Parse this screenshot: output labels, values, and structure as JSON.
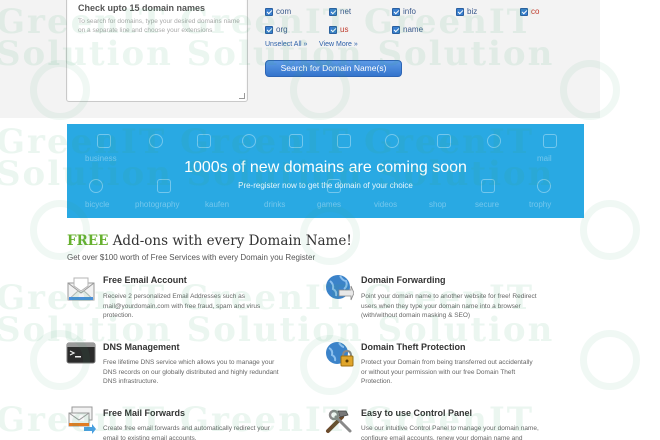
{
  "search": {
    "textarea_title": "Check upto 15 domain names",
    "textarea_hint": "To search for domains, type your desired domains name on a separate line and choose your extensions",
    "tlds": [
      {
        "label": "com",
        "checked": true
      },
      {
        "label": "net",
        "checked": true
      },
      {
        "label": "info",
        "checked": true
      },
      {
        "label": "biz",
        "checked": true
      },
      {
        "label": "co",
        "checked": true
      },
      {
        "label": "org",
        "checked": true
      },
      {
        "label": "us",
        "checked": true
      },
      {
        "label": "name",
        "checked": true
      }
    ],
    "unselect_all": "Unselect All »",
    "view_more": "View More »",
    "button": "Search for Domain Name(s)"
  },
  "banner": {
    "title": "1000s of new domains are coming soon",
    "subtitle": "Pre-register now to get the domain of your choice",
    "bg_words": [
      "business",
      "mail",
      "bicycle",
      "photography",
      "kaufen",
      "drinks",
      "games",
      "videos",
      "shop",
      "secure",
      "trophy"
    ]
  },
  "addons": {
    "heading_free": "FREE",
    "heading_rest": "Add-ons with every Domain Name!",
    "subheading": "Get over $100 worth of Free Services with every Domain you Register",
    "features": [
      {
        "title": "Free Email Account",
        "desc": "Receive 2 personalized Email Addresses such as mail@yourdomain.com with free fraud, spam and virus protection.",
        "icon": "envelope-icon"
      },
      {
        "title": "Domain Forwarding",
        "desc": "Point your domain name to another website for free! Redirect users when they type your domain name into a browser (with/without domain masking & SEO)",
        "icon": "globe-arrow-icon"
      },
      {
        "title": "DNS Management",
        "desc": "Free lifetime DNS service which allows you to manage your DNS records on our globally distributed and highly redundant DNS infrastructure.",
        "icon": "terminal-icon"
      },
      {
        "title": "Domain Theft Protection",
        "desc": "Protect your Domain from being transferred out accidentally or without your permission with our free Domain Theft Protection.",
        "icon": "globe-lock-icon"
      },
      {
        "title": "Free Mail Forwards",
        "desc": "Create free email forwards and automatically redirect your email to existing email accounts.",
        "icon": "mail-stack-icon"
      },
      {
        "title": "Easy to use Control Panel",
        "desc": "Use our intuitive Control Panel to manage your domain name, configure email accounts, renew your domain name and more.",
        "icon": "tools-icon"
      }
    ]
  },
  "watermark": {
    "line1": "GreenIT GreenIT GreenIT",
    "line2": "Solution Solution Solution"
  },
  "colors": {
    "banner": "#29a9e3",
    "free_green": "#66b02e",
    "button_blue": "#3474cc",
    "link_blue": "#2c5fa8"
  }
}
